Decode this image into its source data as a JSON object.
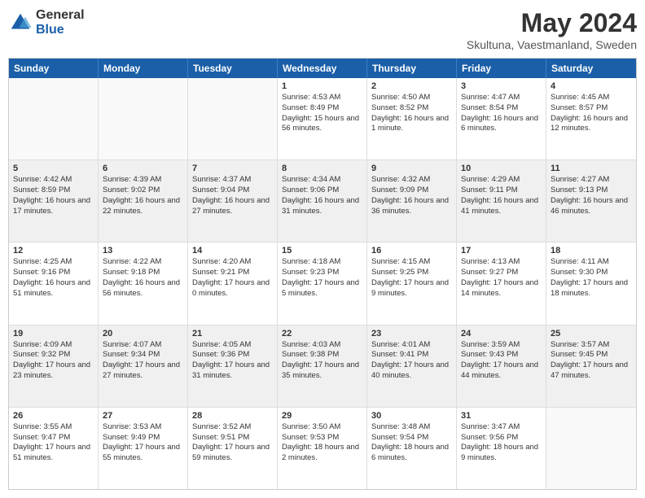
{
  "logo": {
    "general": "General",
    "blue": "Blue"
  },
  "header": {
    "title": "May 2024",
    "subtitle": "Skultuna, Vaestmanland, Sweden"
  },
  "weekdays": [
    "Sunday",
    "Monday",
    "Tuesday",
    "Wednesday",
    "Thursday",
    "Friday",
    "Saturday"
  ],
  "weeks": [
    [
      {
        "day": "",
        "info": "",
        "empty": true
      },
      {
        "day": "",
        "info": "",
        "empty": true
      },
      {
        "day": "",
        "info": "",
        "empty": true
      },
      {
        "day": "1",
        "info": "Sunrise: 4:53 AM\nSunset: 8:49 PM\nDaylight: 15 hours and 56 minutes."
      },
      {
        "day": "2",
        "info": "Sunrise: 4:50 AM\nSunset: 8:52 PM\nDaylight: 16 hours and 1 minute."
      },
      {
        "day": "3",
        "info": "Sunrise: 4:47 AM\nSunset: 8:54 PM\nDaylight: 16 hours and 6 minutes."
      },
      {
        "day": "4",
        "info": "Sunrise: 4:45 AM\nSunset: 8:57 PM\nDaylight: 16 hours and 12 minutes."
      }
    ],
    [
      {
        "day": "5",
        "info": "Sunrise: 4:42 AM\nSunset: 8:59 PM\nDaylight: 16 hours and 17 minutes."
      },
      {
        "day": "6",
        "info": "Sunrise: 4:39 AM\nSunset: 9:02 PM\nDaylight: 16 hours and 22 minutes."
      },
      {
        "day": "7",
        "info": "Sunrise: 4:37 AM\nSunset: 9:04 PM\nDaylight: 16 hours and 27 minutes."
      },
      {
        "day": "8",
        "info": "Sunrise: 4:34 AM\nSunset: 9:06 PM\nDaylight: 16 hours and 31 minutes."
      },
      {
        "day": "9",
        "info": "Sunrise: 4:32 AM\nSunset: 9:09 PM\nDaylight: 16 hours and 36 minutes."
      },
      {
        "day": "10",
        "info": "Sunrise: 4:29 AM\nSunset: 9:11 PM\nDaylight: 16 hours and 41 minutes."
      },
      {
        "day": "11",
        "info": "Sunrise: 4:27 AM\nSunset: 9:13 PM\nDaylight: 16 hours and 46 minutes."
      }
    ],
    [
      {
        "day": "12",
        "info": "Sunrise: 4:25 AM\nSunset: 9:16 PM\nDaylight: 16 hours and 51 minutes."
      },
      {
        "day": "13",
        "info": "Sunrise: 4:22 AM\nSunset: 9:18 PM\nDaylight: 16 hours and 56 minutes."
      },
      {
        "day": "14",
        "info": "Sunrise: 4:20 AM\nSunset: 9:21 PM\nDaylight: 17 hours and 0 minutes."
      },
      {
        "day": "15",
        "info": "Sunrise: 4:18 AM\nSunset: 9:23 PM\nDaylight: 17 hours and 5 minutes."
      },
      {
        "day": "16",
        "info": "Sunrise: 4:15 AM\nSunset: 9:25 PM\nDaylight: 17 hours and 9 minutes."
      },
      {
        "day": "17",
        "info": "Sunrise: 4:13 AM\nSunset: 9:27 PM\nDaylight: 17 hours and 14 minutes."
      },
      {
        "day": "18",
        "info": "Sunrise: 4:11 AM\nSunset: 9:30 PM\nDaylight: 17 hours and 18 minutes."
      }
    ],
    [
      {
        "day": "19",
        "info": "Sunrise: 4:09 AM\nSunset: 9:32 PM\nDaylight: 17 hours and 23 minutes."
      },
      {
        "day": "20",
        "info": "Sunrise: 4:07 AM\nSunset: 9:34 PM\nDaylight: 17 hours and 27 minutes."
      },
      {
        "day": "21",
        "info": "Sunrise: 4:05 AM\nSunset: 9:36 PM\nDaylight: 17 hours and 31 minutes."
      },
      {
        "day": "22",
        "info": "Sunrise: 4:03 AM\nSunset: 9:38 PM\nDaylight: 17 hours and 35 minutes."
      },
      {
        "day": "23",
        "info": "Sunrise: 4:01 AM\nSunset: 9:41 PM\nDaylight: 17 hours and 40 minutes."
      },
      {
        "day": "24",
        "info": "Sunrise: 3:59 AM\nSunset: 9:43 PM\nDaylight: 17 hours and 44 minutes."
      },
      {
        "day": "25",
        "info": "Sunrise: 3:57 AM\nSunset: 9:45 PM\nDaylight: 17 hours and 47 minutes."
      }
    ],
    [
      {
        "day": "26",
        "info": "Sunrise: 3:55 AM\nSunset: 9:47 PM\nDaylight: 17 hours and 51 minutes."
      },
      {
        "day": "27",
        "info": "Sunrise: 3:53 AM\nSunset: 9:49 PM\nDaylight: 17 hours and 55 minutes."
      },
      {
        "day": "28",
        "info": "Sunrise: 3:52 AM\nSunset: 9:51 PM\nDaylight: 17 hours and 59 minutes."
      },
      {
        "day": "29",
        "info": "Sunrise: 3:50 AM\nSunset: 9:53 PM\nDaylight: 18 hours and 2 minutes."
      },
      {
        "day": "30",
        "info": "Sunrise: 3:48 AM\nSunset: 9:54 PM\nDaylight: 18 hours and 6 minutes."
      },
      {
        "day": "31",
        "info": "Sunrise: 3:47 AM\nSunset: 9:56 PM\nDaylight: 18 hours and 9 minutes."
      },
      {
        "day": "",
        "info": "",
        "empty": true
      }
    ]
  ]
}
